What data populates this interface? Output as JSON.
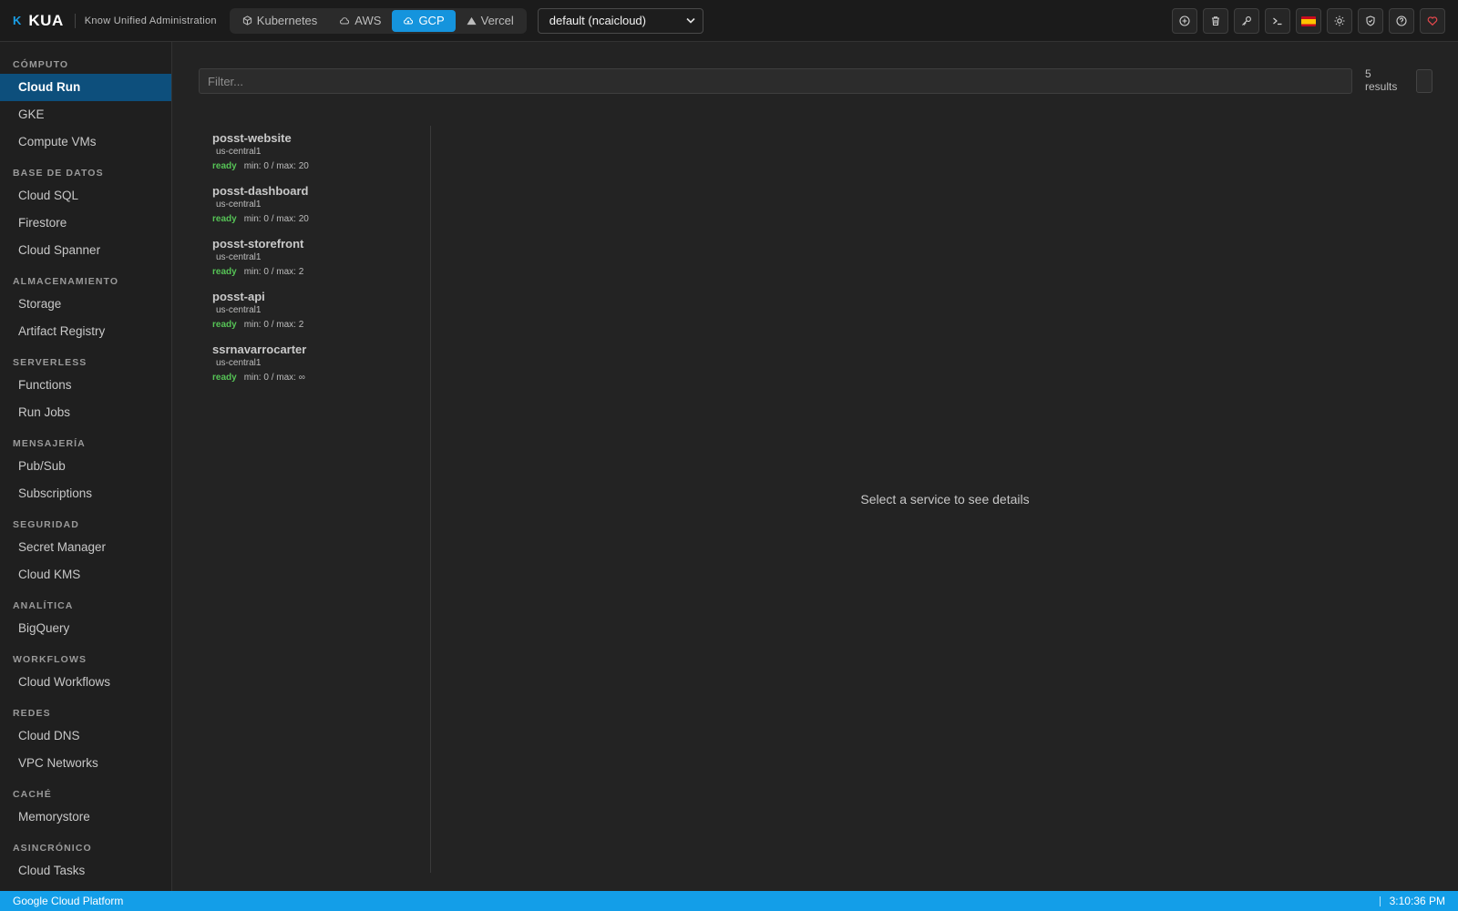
{
  "app": {
    "logo_glyph": "K",
    "name": "KUA",
    "subtitle": "Know Unified Administration"
  },
  "providers": [
    {
      "label": "Kubernetes",
      "icon": "cube-icon",
      "active": false
    },
    {
      "label": "AWS",
      "icon": "cloud-icon",
      "active": false
    },
    {
      "label": "GCP",
      "icon": "cloud-upload-icon",
      "active": true
    },
    {
      "label": "Vercel",
      "icon": "triangle-icon",
      "active": false
    }
  ],
  "context": {
    "selected": "default (ncaicloud)"
  },
  "toolbar": {
    "icons": [
      "add-circle-icon",
      "trash-icon",
      "key-icon",
      "terminal-icon",
      "spain-flag-icon",
      "sun-icon",
      "shield-icon",
      "help-icon",
      "heart-icon"
    ],
    "heart_color": "#e5484d"
  },
  "sidebar": {
    "sections": [
      {
        "title": "CÓMPUTO",
        "items": [
          "Cloud Run",
          "GKE",
          "Compute VMs"
        ]
      },
      {
        "title": "BASE DE DATOS",
        "items": [
          "Cloud SQL",
          "Firestore",
          "Cloud Spanner"
        ]
      },
      {
        "title": "ALMACENAMIENTO",
        "items": [
          "Storage",
          "Artifact Registry"
        ]
      },
      {
        "title": "SERVERLESS",
        "items": [
          "Functions",
          "Run Jobs"
        ]
      },
      {
        "title": "MENSAJERÍA",
        "items": [
          "Pub/Sub",
          "Subscriptions"
        ]
      },
      {
        "title": "SEGURIDAD",
        "items": [
          "Secret Manager",
          "Cloud KMS"
        ]
      },
      {
        "title": "ANALÍTICA",
        "items": [
          "BigQuery"
        ]
      },
      {
        "title": "WORKFLOWS",
        "items": [
          "Cloud Workflows"
        ]
      },
      {
        "title": "REDES",
        "items": [
          "Cloud DNS",
          "VPC Networks"
        ]
      },
      {
        "title": "CACHÉ",
        "items": [
          "Memorystore"
        ]
      },
      {
        "title": "ASINCRÓNICO",
        "items": [
          "Cloud Tasks"
        ]
      }
    ],
    "active_item": "Cloud Run"
  },
  "filter": {
    "placeholder": "Filter...",
    "value": ""
  },
  "results": {
    "count": "5",
    "label": "results"
  },
  "services": [
    {
      "name": "posst-website",
      "region": "us-central1",
      "status": "ready",
      "scaling": "min: 0 / max: 20"
    },
    {
      "name": "posst-dashboard",
      "region": "us-central1",
      "status": "ready",
      "scaling": "min: 0 / max: 20"
    },
    {
      "name": "posst-storefront",
      "region": "us-central1",
      "status": "ready",
      "scaling": "min: 0 / max: 2"
    },
    {
      "name": "posst-api",
      "region": "us-central1",
      "status": "ready",
      "scaling": "min: 0 / max: 2"
    },
    {
      "name": "ssrnavarrocarter",
      "region": "us-central1",
      "status": "ready",
      "scaling": "min: 0 / max: ∞"
    }
  ],
  "detail": {
    "empty_text": "Select a service to see details"
  },
  "statusbar": {
    "left": "Google Cloud Platform",
    "time": "3:10:36 PM"
  },
  "colors": {
    "accent": "#1594dd",
    "sidebar_active": "#0d4f7c",
    "status_ready": "#56c356",
    "statusbar": "#139ee8"
  }
}
